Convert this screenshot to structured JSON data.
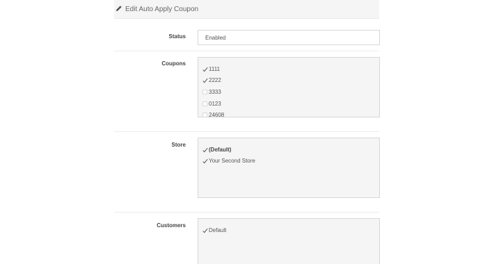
{
  "panel": {
    "title": "Edit Auto Apply Coupon",
    "icon": "pencil-icon"
  },
  "status": {
    "label": "Status",
    "value": "Enabled"
  },
  "coupons": {
    "label": "Coupons",
    "items": [
      {
        "text": "1111",
        "checked": true
      },
      {
        "text": "2222",
        "checked": true
      },
      {
        "text": "3333",
        "checked": false
      },
      {
        "text": "0123",
        "checked": false
      },
      {
        "text": "24608",
        "checked": false
      }
    ]
  },
  "store": {
    "label": "Store",
    "items": [
      {
        "text": "(Default)",
        "checked": true
      },
      {
        "text": "Your Second Store",
        "checked": true
      }
    ]
  },
  "customers": {
    "label": "Customers",
    "items": [
      {
        "text": "Default",
        "checked": true
      }
    ]
  },
  "colors": {
    "panel_heading_bg": "#f5f5f5",
    "well_bg": "#f5f5f5",
    "border": "#d7d7d7",
    "label_text": "#444444",
    "body_text": "#555555"
  }
}
